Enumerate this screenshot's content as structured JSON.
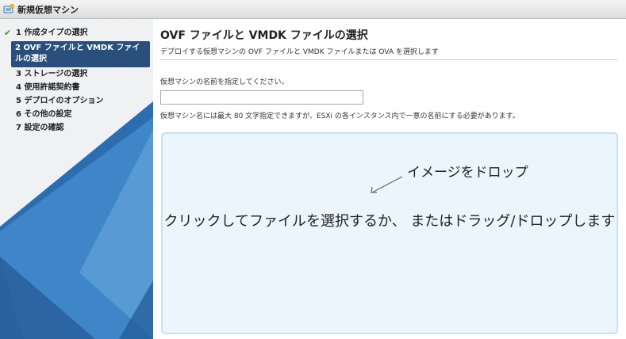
{
  "window": {
    "title": "新規仮想マシン",
    "icon": "new-vm-icon"
  },
  "sidebar": {
    "steps": [
      {
        "label": "1 作成タイプの選択",
        "completed": true,
        "icon": "checkmark-icon"
      },
      {
        "label": "2 OVF ファイルと VMDK ファイルの選択",
        "active": true
      },
      {
        "label": "3 ストレージの選択"
      },
      {
        "label": "4 使用許諾契約書"
      },
      {
        "label": "5 デプロイのオプション"
      },
      {
        "label": "6 その他の設定"
      },
      {
        "label": "7 設定の確認"
      }
    ]
  },
  "main": {
    "title": "OVF ファイルと VMDK ファイルの選択",
    "subtitle": "デプロイする仮想マシンの OVF ファイルと VMDK ファイルまたは OVA を選択します",
    "name_label": "仮想マシンの名前を指定してください。",
    "name_value": "",
    "name_placeholder": "",
    "name_hint": "仮想マシン名には最大 80 文字指定できますが、ESXi の各インスタンス内で一意の名前にする必要があります。",
    "dropzone": {
      "hint": "イメージをドロップ",
      "text": "クリックしてファイルを選択するか、 またはドラッグ/ドロップします"
    }
  },
  "colors": {
    "active_step_bg": "#2a4f7c",
    "check_green": "#4a9a1e",
    "dropzone_bg": "#eaf6fb",
    "dropzone_border": "#c5e3f1",
    "sidebar_wave": "#3f86c8"
  }
}
